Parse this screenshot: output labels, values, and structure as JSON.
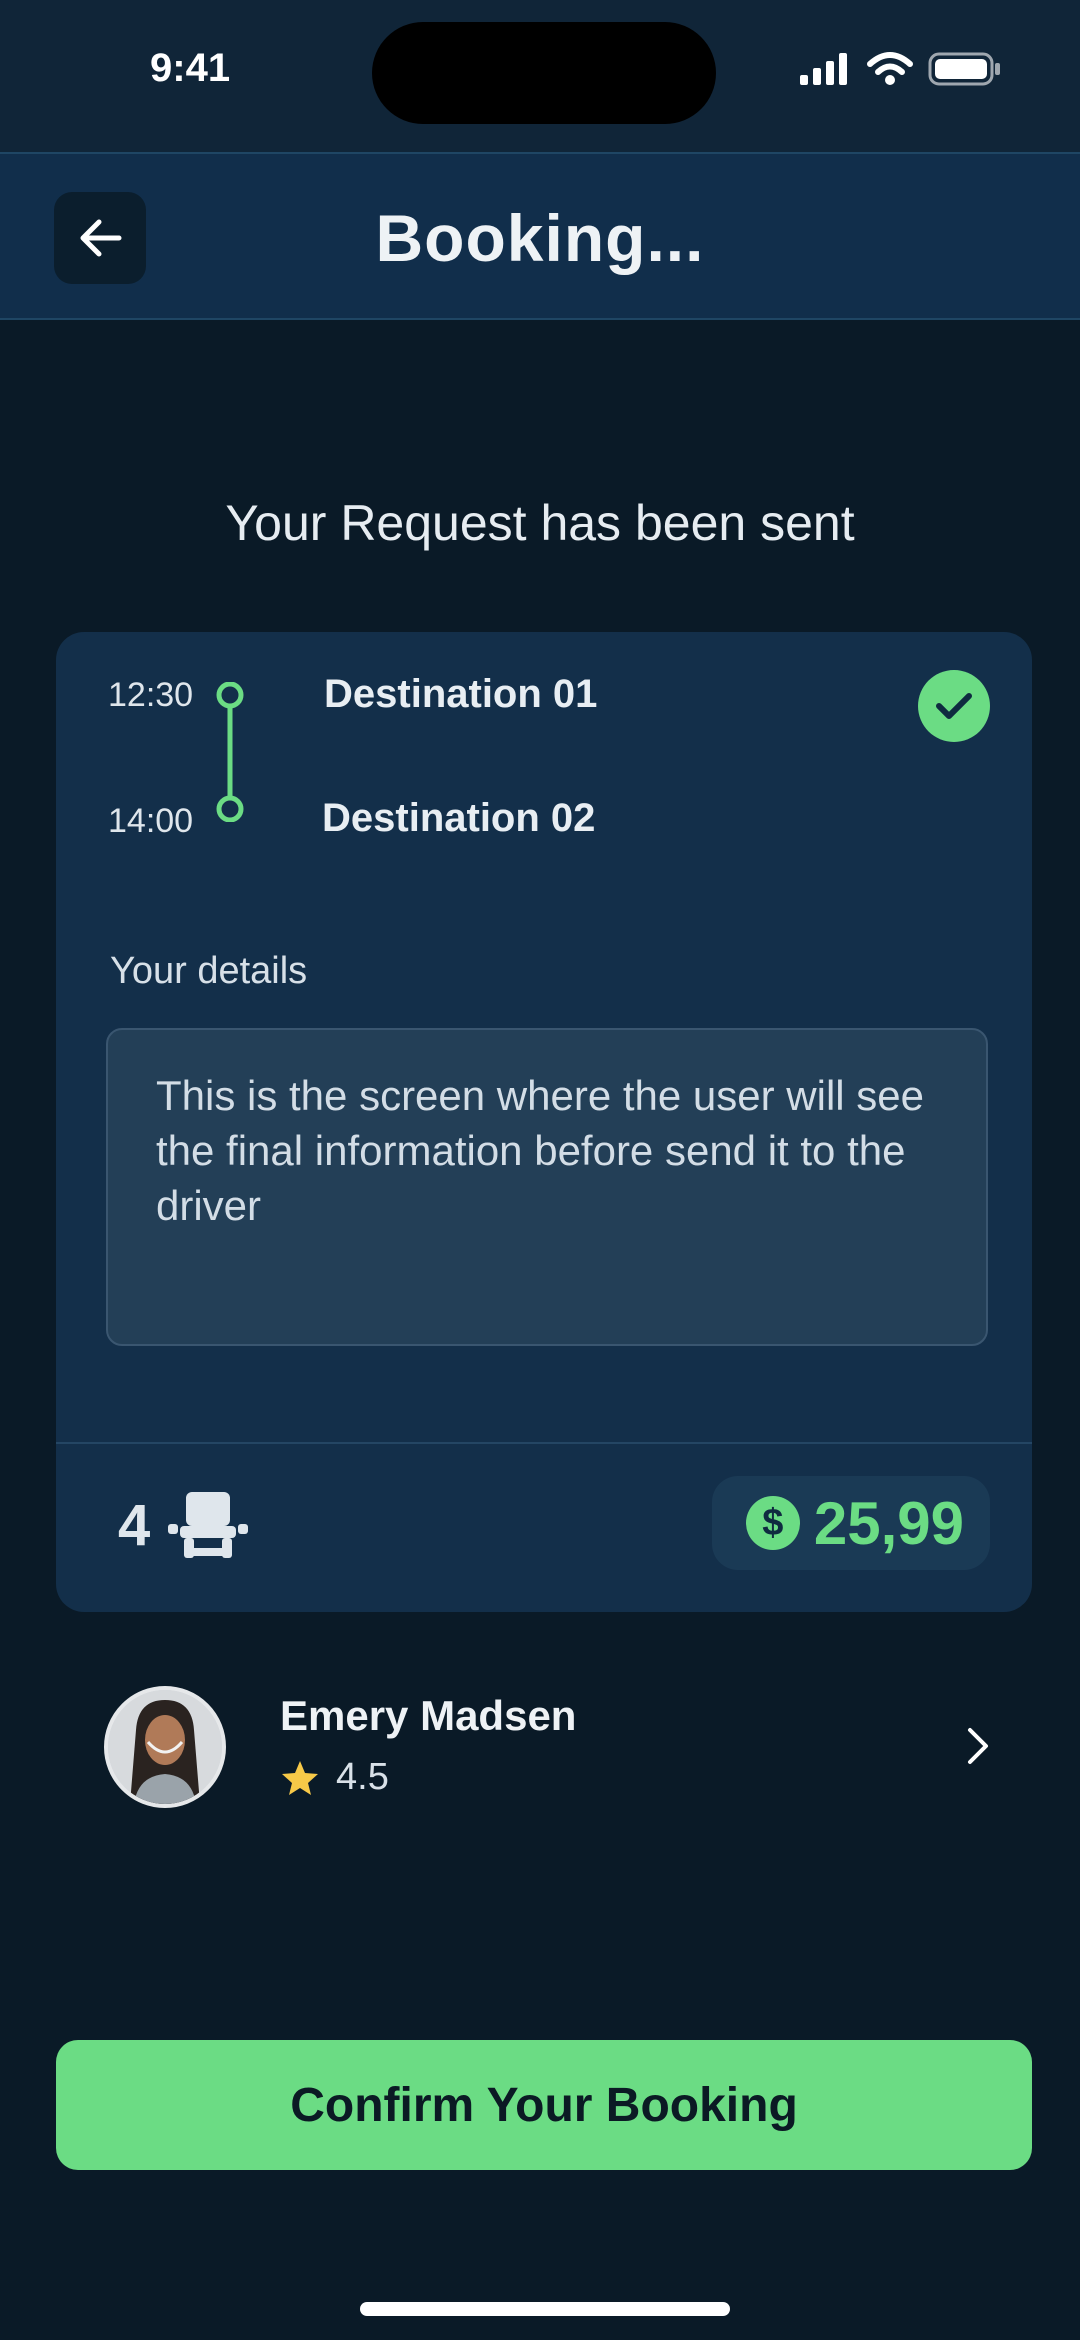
{
  "status_bar": {
    "time": "9:41"
  },
  "header": {
    "title": "Booking..."
  },
  "request": {
    "title": "Your Request has been sent"
  },
  "trip": {
    "stops": [
      {
        "time": "12:30",
        "destination": "Destination 01"
      },
      {
        "time": "14:00",
        "destination": "Destination 02"
      }
    ]
  },
  "details": {
    "label": "Your details",
    "text": "This is the screen where the user will see the final information before send it to the driver"
  },
  "booking": {
    "seats": "4",
    "price": "25,99",
    "currency_symbol": "$"
  },
  "driver": {
    "name": "Emery Madsen",
    "rating": "4.5"
  },
  "actions": {
    "confirm_label": "Confirm Your Booking"
  },
  "colors": {
    "accent": "#6bdc84",
    "background": "#0a1a27",
    "card": "#132f4a",
    "header": "#112e4b"
  },
  "icons": [
    "signal-icon",
    "wifi-icon",
    "battery-icon",
    "back-arrow-icon",
    "check-icon",
    "seat-icon",
    "dollar-icon",
    "star-icon",
    "chevron-right-icon"
  ]
}
